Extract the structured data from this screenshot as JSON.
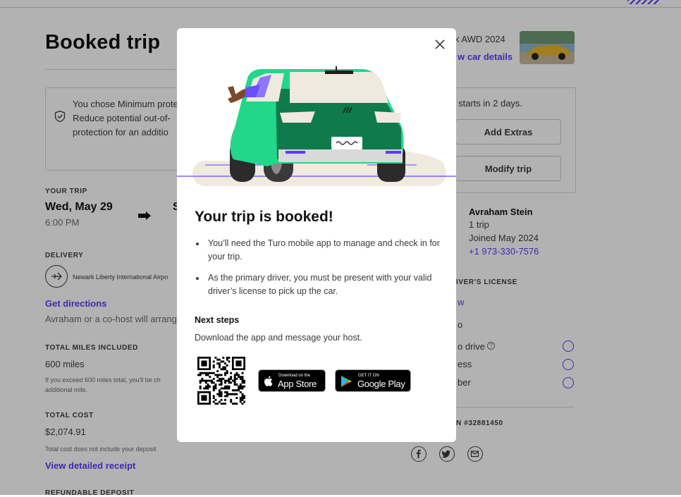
{
  "page": {
    "title": "Booked trip",
    "vehicle_name_partial": "k AWD 2024",
    "view_car_details": "w car details",
    "protection": {
      "lines": [
        "You chose Minimum prote",
        "Reduce potential out-of-",
        "protection for an additio"
      ]
    },
    "trip": {
      "label": "YOUR TRIP",
      "start_date": "Wed, May 29",
      "start_time": "6:00 PM",
      "end_date_partial": "S"
    },
    "delivery": {
      "label": "DELIVERY",
      "location": "Newark Liberty International Airpo",
      "directions_link": "Get directions",
      "note": "Avraham or a co-host will arrang"
    },
    "miles": {
      "label": "TOTAL MILES INCLUDED",
      "value": "600 miles",
      "note_line1": "If you exceed 600 miles total, you'll be ch",
      "note_line2": "additional mile."
    },
    "cost": {
      "label": "TOTAL COST",
      "value": "$2,074.91",
      "note": "Total cost does not include your deposit",
      "receipt_link": "View detailed receipt"
    },
    "deposit_label": "REFUNDABLE DEPOSIT",
    "right": {
      "starts_text": "starts in 2 days.",
      "add_extras": "Add Extras",
      "modify_trip": "Modify trip",
      "host_name": "Avraham Stein",
      "host_trips": "1 trip",
      "host_joined": "Joined May 2024",
      "host_phone": "+1 973-330-7576",
      "license_label": "IVER'S LICENSE",
      "license_link": "w",
      "req_1": "o",
      "req_2": "o drive",
      "req_3": "ess",
      "req_4": "ber",
      "reservation": "N #32881450"
    }
  },
  "modal": {
    "title": "Your trip is booked!",
    "bullets": [
      "You’ll need the Turo mobile app to manage and check in for your trip.",
      "As the primary driver, you must be present with your valid driver’s license to pick up the car."
    ],
    "next_steps_title": "Next steps",
    "next_steps_desc": "Download the app and message your host.",
    "app_store_small": "Download on the",
    "app_store_big": "App Store",
    "google_play_small": "GET IT ON",
    "google_play_big": "Google Play",
    "plate_text": "~~~"
  },
  "colors": {
    "accent": "#593cfb",
    "car_green": "#1fd68a",
    "car_dark_green": "#0f8a55",
    "overlay": "rgba(0,0,0,0.30)"
  }
}
